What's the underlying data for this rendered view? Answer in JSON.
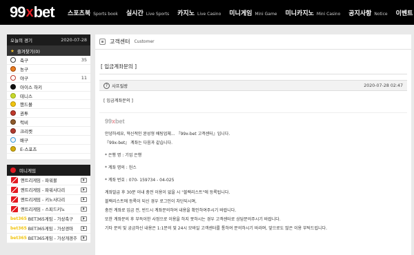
{
  "brand": {
    "left": "99",
    "x": "x",
    "right": "bet"
  },
  "nav": [
    {
      "ko": "스포츠북",
      "en": "Sports book"
    },
    {
      "ko": "실시간",
      "en": "Live Sports"
    },
    {
      "ko": "카지노",
      "en": "Live Casino"
    },
    {
      "ko": "미니게임",
      "en": "Mini Game"
    },
    {
      "ko": "미니카지노",
      "en": "Mini Casino"
    },
    {
      "ko": "공지사항",
      "en": "Notice"
    },
    {
      "ko": "이벤트",
      "en": ""
    }
  ],
  "sidebar": {
    "today_label": "오늘의 경기",
    "today_date": "2020-07-28",
    "favorites_label": "즐겨찾기(0)",
    "sports": [
      {
        "name": "축구",
        "count": "35",
        "color": "#ffffff",
        "ring": "#333333"
      },
      {
        "name": "농구",
        "count": "",
        "color": "#e67e22",
        "ring": "#a04000"
      },
      {
        "name": "야구",
        "count": "11",
        "color": "#ffffff",
        "ring": "#c0392b"
      },
      {
        "name": "아이스 하키",
        "count": "",
        "color": "#111111",
        "ring": "#111111"
      },
      {
        "name": "테니스",
        "count": "",
        "color": "#c7d92b",
        "ring": "#9aa71d"
      },
      {
        "name": "핸드볼",
        "count": "",
        "color": "#f1c40f",
        "ring": "#b7950b"
      },
      {
        "name": "권투",
        "count": "",
        "color": "#c0392b",
        "ring": "#7b241c"
      },
      {
        "name": "럭비",
        "count": "",
        "color": "#8e5a2b",
        "ring": "#5e3a1a"
      },
      {
        "name": "크리켓",
        "count": "",
        "color": "#b03a2e",
        "ring": "#78281f"
      },
      {
        "name": "배구",
        "count": "",
        "color": "#f4f4f4",
        "ring": "#3498db"
      },
      {
        "name": "E-스포츠",
        "count": "",
        "color": "#d4ac0d",
        "ring": "#9a7d0a"
      }
    ],
    "mini_label": "미니게임",
    "games": [
      {
        "prefix": "",
        "name": "엔트리게임 - 파워볼",
        "icon": "ntry"
      },
      {
        "prefix": "",
        "name": "엔트리게임 - 파워사다리",
        "icon": "ntry"
      },
      {
        "prefix": "",
        "name": "엔트리게임 - 키노사다리",
        "icon": "ntry"
      },
      {
        "prefix": "",
        "name": "엔트리게임 - 스피드키노",
        "icon": "ntry"
      },
      {
        "prefix": "bet365",
        "name": "BET365게임 - 가상축구",
        "icon": "bet365"
      },
      {
        "prefix": "bet365",
        "name": "BET365게임 - 가상경마",
        "icon": "bet365"
      },
      {
        "prefix": "bet365",
        "name": "BET365게임 - 가상개경주",
        "icon": "bet365"
      }
    ]
  },
  "main": {
    "title": "고객센터",
    "subtitle": "Customer",
    "section_title": "[ 입금계좌문의 ]",
    "author": "사프릴랑",
    "timestamp": "2020-07-28 02:47",
    "subject": "[ 입금계좌문의 ]",
    "body_logo_left": "99",
    "body_logo_x": "x",
    "body_logo_right": "bet",
    "body": [
      "안녕하세요, 혁신적인 완성형 배팅업체... 『99x-bet 고객센터』입니다.",
      "『99x-bet』 계좌는 다음과 같습니다.",
      "",
      "* 은행 명 : 기업 은행",
      "",
      "* 계좌 명의 : 헌스",
      "",
      "* 계좌 번호 : 070- 159734 - 04-025",
      "",
      "계좌발급 후 30분 이내 충전 이용이 없을 시 \"블랙리스트\"에 등록됩니다.",
      "블랙리스트에 등록이 되신 경우 로그인이 차단되시며,",
      "충전 계좌로 입금 전, 반드시 계좌문의하여 내용을 확인하여주시기 바랍니다.",
      "또한 계좌문의 후 부득이한 사정으로 이용을 하지 못하시는 경우 고객센터로 상담문의주시기 바랍니다.",
      "기타 문의 및 궁금하신 내용은 1:1문의 및 24시 모바일 고객센터를 통하여 문의하시기 바라며, 앞으로도 많은 이용 부탁드립니다."
    ]
  }
}
